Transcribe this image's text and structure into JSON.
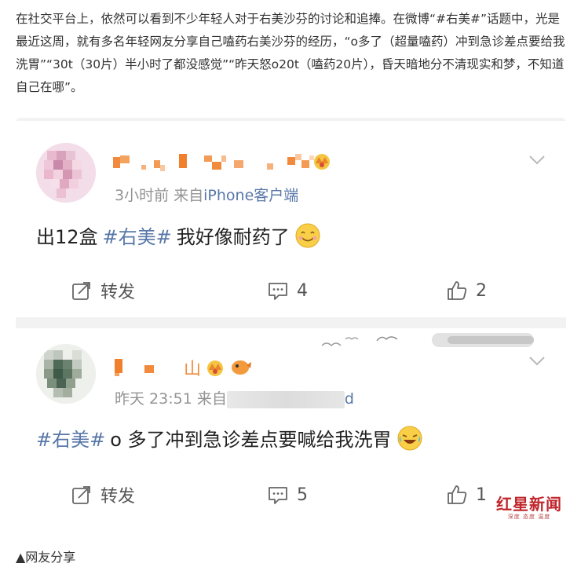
{
  "article": {
    "paragraph": "在社交平台上，依然可以看到不少年轻人对于右美沙芬的讨论和追捧。在微博“#右美#”话题中，光是最近这周，就有多名年轻网友分享自己嗑药右美沙芬的经历，“o多了（超量嗑药）冲到急诊差点要给我洗胃”“30t（30片）半小时了都没感觉”“昨天怒o20t（嗑药20片），昏天暗地分不清现实和梦，不知道自己在哪”。"
  },
  "posts": [
    {
      "time": "3小时前",
      "source_prefix": "来自",
      "source": "iPhone客户端",
      "topic": "#右美#",
      "text_before": "出12盒",
      "text_after": " 我好像耐药了",
      "emoji_icon": "smile-emoji-icon",
      "repost_label": "转发",
      "comment_count": "4",
      "like_count": "2"
    },
    {
      "time": "昨天 23:51",
      "source_prefix": "来自",
      "source_suffix": "d",
      "name_char": "山",
      "topic": "#右美#",
      "text_after": "o 多了冲到急诊差点要喊给我洗胃",
      "emoji_icon": "laugh-cry-emoji-icon",
      "repost_label": "转发",
      "comment_count": "5",
      "like_count": "1"
    }
  ],
  "watermark": {
    "main": "红星新闻",
    "sub": "深度 态度 温度"
  },
  "caption": "▲网友分享",
  "colors": {
    "topic": "#5877a8",
    "meta": "#939393",
    "watermark": "#c0262c"
  }
}
